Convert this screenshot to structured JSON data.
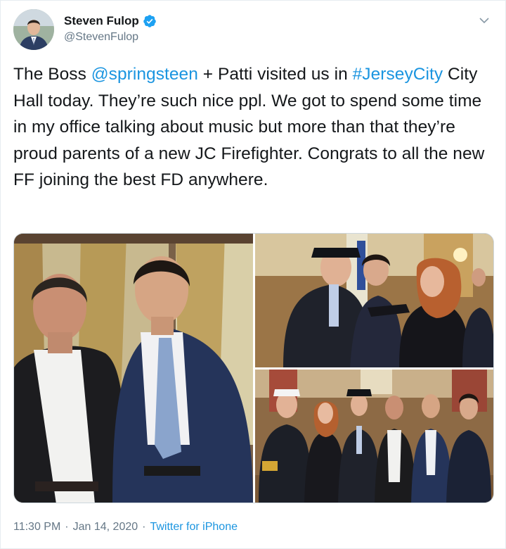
{
  "author": {
    "display_name": "Steven Fulop",
    "handle": "@StevenFulop",
    "verified": true
  },
  "icons": {
    "verified": "verified-badge-icon",
    "menu": "chevron-down-icon"
  },
  "tweet": {
    "t1": "The Boss ",
    "mention": "@springsteen",
    "t2": " + Patti visited us in ",
    "hashtag": "#JerseyCity",
    "t3": " City Hall today. They’re such nice ppl. We got to spend some time in my office talking about music but more than that they’re proud parents of a new JC Firefighter. Congrats to all the new FF joining the best FD anywhere."
  },
  "footer": {
    "time": "11:30 PM",
    "separator": "·",
    "date": "Jan 14, 2020",
    "separator2": "·",
    "source": "Twitter for iPhone"
  },
  "colors": {
    "link": "#1b95e0",
    "verified": "#1da1f2",
    "secondary_text": "#657786"
  }
}
